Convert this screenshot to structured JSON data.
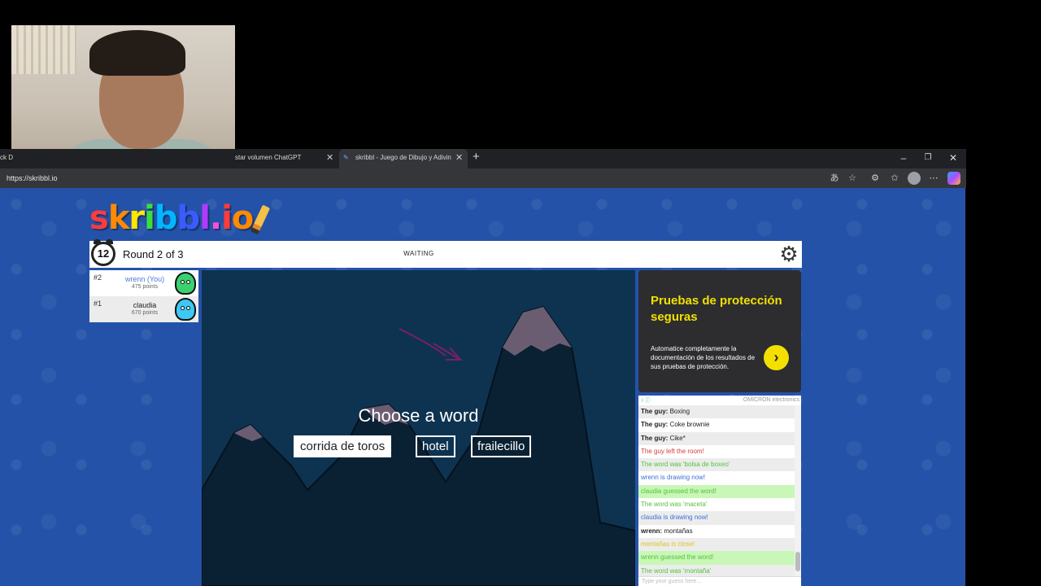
{
  "browser": {
    "tabs": [
      {
        "title": "ck D"
      },
      {
        "title": "star volumen ChatGPT"
      },
      {
        "title": "skribbl - Juego de Dibujo y Adivin",
        "active": true
      }
    ],
    "new_tab": "+",
    "url": "https://skribbl.io",
    "window_controls": [
      "–",
      "❐",
      "✕"
    ],
    "toolbar_icons": [
      "translate-icon",
      "favorite-star-icon",
      "extensions-icon",
      "favorites-icon",
      "profile-icon",
      "more-icon",
      "copilot-icon"
    ]
  },
  "game": {
    "logo_letters": [
      {
        "ch": "s",
        "color": "#ff3b3b"
      },
      {
        "ch": "k",
        "color": "#ff8a00"
      },
      {
        "ch": "r",
        "color": "#ffe600"
      },
      {
        "ch": "i",
        "color": "#3cde3c"
      },
      {
        "ch": "b",
        "color": "#00b7ff"
      },
      {
        "ch": "b",
        "color": "#3b5bff"
      },
      {
        "ch": "l",
        "color": "#b03bff"
      },
      {
        "ch": ".",
        "color": "#ff4fd8"
      },
      {
        "ch": "i",
        "color": "#ff3b3b"
      },
      {
        "ch": "o",
        "color": "#ff8a00"
      }
    ],
    "timer": "12",
    "round": "Round 2 of 3",
    "status": "WAITING",
    "players": [
      {
        "rank": "#2",
        "name": "wrenn (You)",
        "points": "475 points",
        "avatar_color": "#3bd16f",
        "is_you": true
      },
      {
        "rank": "#1",
        "name": "claudia",
        "points": "670 points",
        "avatar_color": "#3dc8f5",
        "is_you": false
      }
    ],
    "prompt": "Choose a word",
    "words": [
      "corrida de toros",
      "hotel",
      "frailecillo"
    ],
    "selected_word": 0
  },
  "ad": {
    "title": "Pruebas de protección seguras",
    "body": "Automatice completamente la documentación de los resultados de sus pruebas de protección.",
    "arrow": "›",
    "footer_left": "i ⓘ",
    "footer_right": "OMICRON electronics"
  },
  "chat": {
    "messages": [
      {
        "name": "The guy:",
        "text": " Boxing",
        "color": "#222",
        "bg": "alt"
      },
      {
        "name": "The guy:",
        "text": " Coke brownie",
        "color": "#222",
        "bg": ""
      },
      {
        "name": "The guy:",
        "text": " Cike*",
        "color": "#222",
        "bg": "alt"
      },
      {
        "name": "",
        "text": "The guy left the room!",
        "color": "#d83b3b",
        "bg": ""
      },
      {
        "name": "",
        "text": "The word was 'bolsa de boxeo'",
        "color": "#54c23a",
        "bg": "alt"
      },
      {
        "name": "",
        "text": "wrenn is drawing now!",
        "color": "#3b6fd8",
        "bg": ""
      },
      {
        "name": "",
        "text": "claudia guessed the word!",
        "color": "#54c23a",
        "bg": "green"
      },
      {
        "name": "",
        "text": "The word was 'maceta'",
        "color": "#54c23a",
        "bg": ""
      },
      {
        "name": "",
        "text": "claudia is drawing now!",
        "color": "#3b6fd8",
        "bg": "alt"
      },
      {
        "name": "wrenn:",
        "text": " montañas",
        "color": "#222",
        "bg": ""
      },
      {
        "name": "",
        "text": "montañas is close!",
        "color": "#e3c21a",
        "bg": "alt"
      },
      {
        "name": "",
        "text": "wrenn guessed the word!",
        "color": "#54c23a",
        "bg": "green"
      },
      {
        "name": "",
        "text": "The word was 'montaña'",
        "color": "#54c23a",
        "bg": "alt"
      }
    ],
    "input_placeholder": "Type your guess here..."
  }
}
